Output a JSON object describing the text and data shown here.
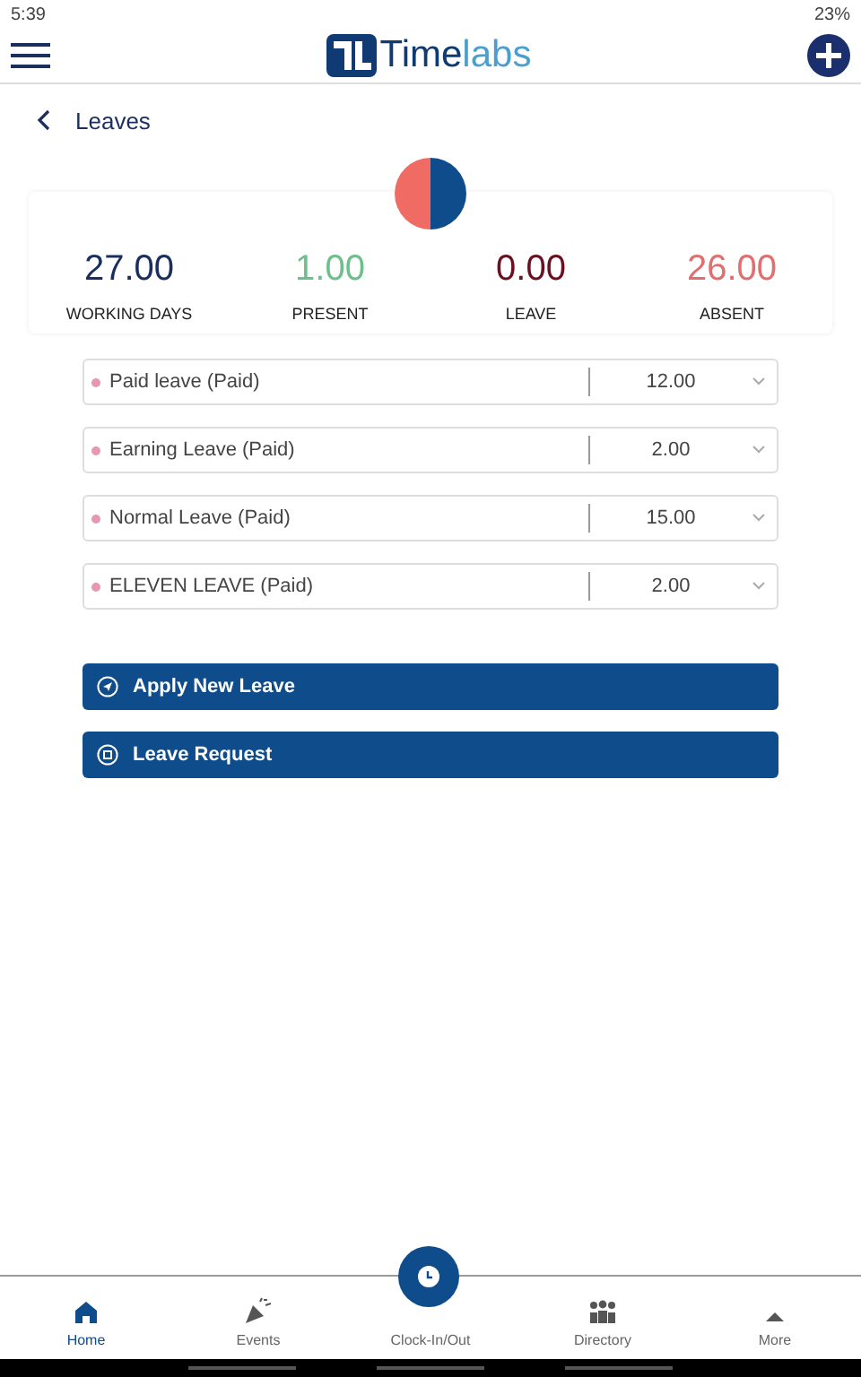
{
  "status_bar": {
    "time": "5:39",
    "battery": "23%"
  },
  "header": {
    "logo": {
      "first": "Time",
      "second": "labs"
    }
  },
  "page": {
    "title": "Leaves"
  },
  "stats": [
    {
      "value": "27.00",
      "label": "WORKING DAYS",
      "color": "#1b2f5e"
    },
    {
      "value": "1.00",
      "label": "PRESENT",
      "color": "#6cc08a"
    },
    {
      "value": "0.00",
      "label": "LEAVE",
      "color": "#6b1020"
    },
    {
      "value": "26.00",
      "label": "ABSENT",
      "color": "#e07070"
    }
  ],
  "leave_types": [
    {
      "name": "Paid leave (Paid)",
      "value": "12.00"
    },
    {
      "name": "Earning Leave (Paid)",
      "value": "2.00"
    },
    {
      "name": "Normal Leave (Paid)",
      "value": "15.00"
    },
    {
      "name": "ELEVEN LEAVE (Paid)",
      "value": "2.00"
    }
  ],
  "actions": [
    {
      "label": "Apply New Leave",
      "kind": "apply"
    },
    {
      "label": "Leave Request",
      "kind": "request"
    }
  ],
  "bottom_nav": [
    {
      "label": "Home",
      "kind": "home",
      "selected": true
    },
    {
      "label": "Events",
      "kind": "events",
      "selected": false
    },
    {
      "label": "Clock-In/Out",
      "kind": "clock",
      "selected": false
    },
    {
      "label": "Directory",
      "kind": "directory",
      "selected": false
    },
    {
      "label": "More",
      "kind": "more",
      "selected": false
    }
  ]
}
